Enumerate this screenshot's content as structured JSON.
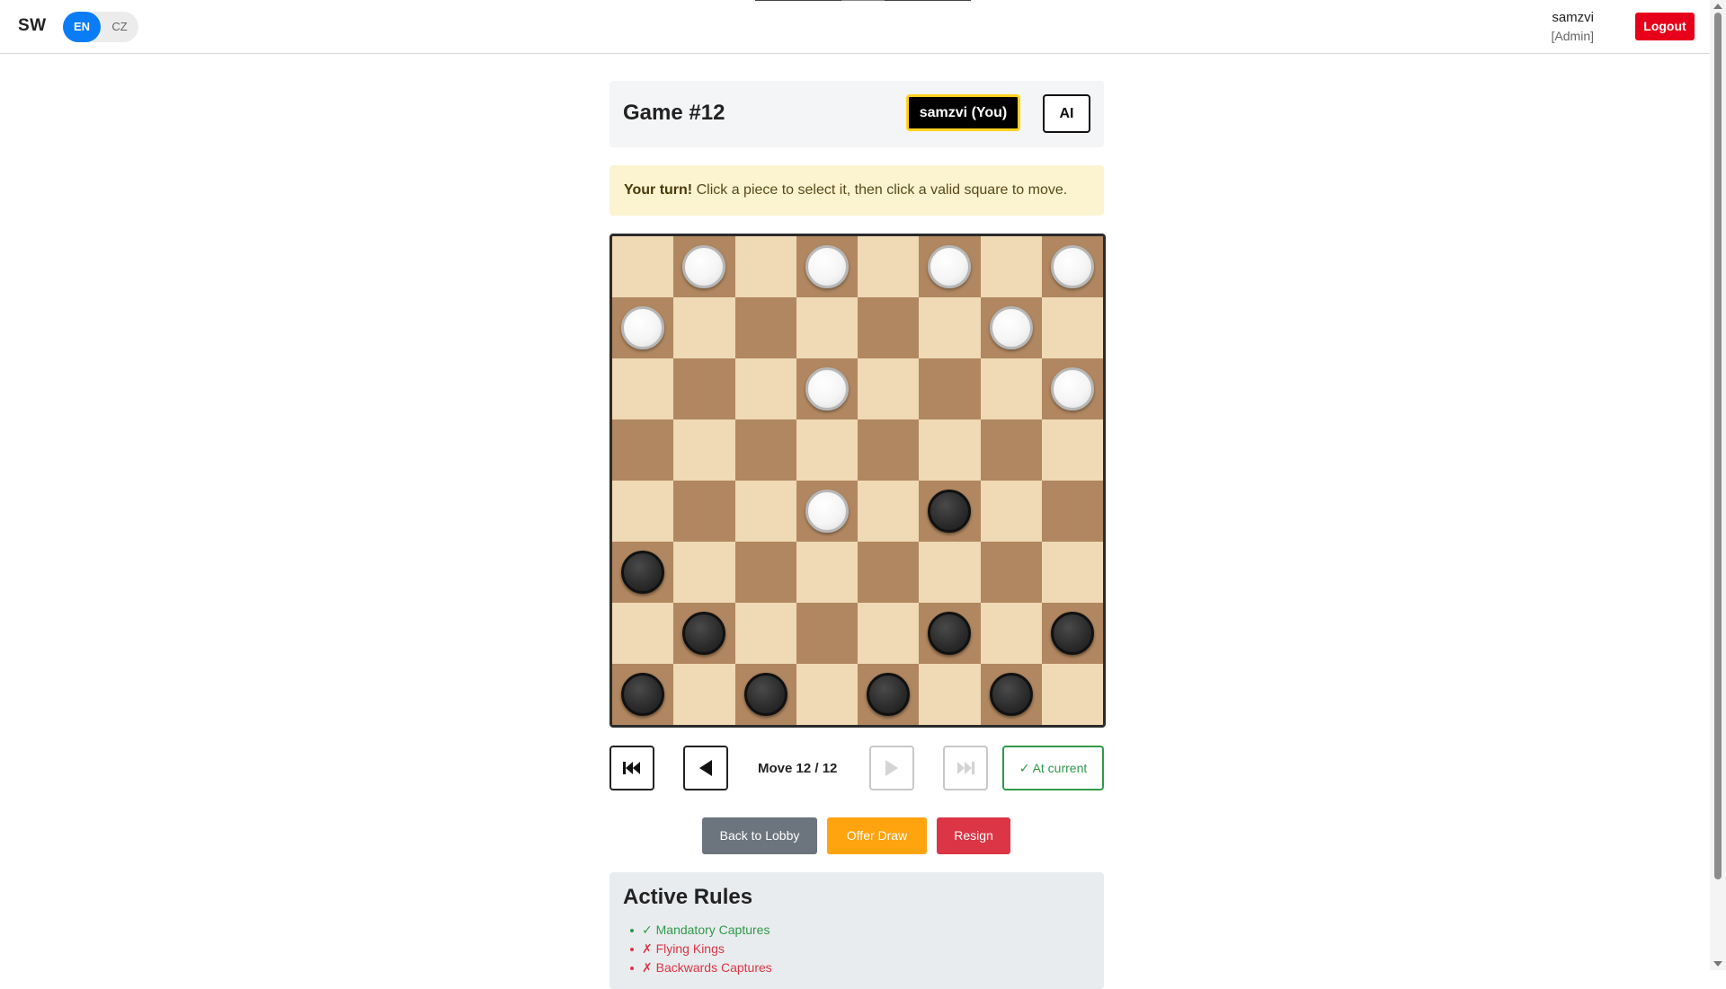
{
  "header": {
    "logo": "SW",
    "languages": [
      {
        "label": "EN",
        "active": true
      },
      {
        "label": "CZ",
        "active": false
      }
    ],
    "user": {
      "name": "samzvi",
      "role": "[Admin]"
    },
    "logout_label": "Logout"
  },
  "game": {
    "title": "Game #12",
    "player_you": "samzvi (You)",
    "player_opponent": "AI",
    "turn_bold": "Your turn!",
    "turn_text": " Click a piece to select it, then click a valid square to move."
  },
  "board": {
    "rows": [
      ". W . W . W . W",
      "W . . . . . W .",
      ". . . W . . . W",
      ". . . . . . . .",
      ". . . W . B . .",
      "B . . . . . . .",
      ". B . . . B . B",
      "B . B . B . B ."
    ],
    "colors": {
      "light_square": "#f0d9b5",
      "dark_square": "#b08760"
    }
  },
  "history": {
    "move_label": "Move 12 / 12",
    "current": 12,
    "total": 12,
    "at_current_label": "✓ At current"
  },
  "actions": {
    "lobby_label": "Back to Lobby",
    "draw_label": "Offer Draw",
    "resign_label": "Resign"
  },
  "rules": {
    "title": "Active Rules",
    "items": [
      {
        "text": "✓ Mandatory Captures",
        "enabled": true
      },
      {
        "text": "✗ Flying Kings",
        "enabled": false
      },
      {
        "text": "✗ Backwards Captures",
        "enabled": false
      }
    ]
  }
}
